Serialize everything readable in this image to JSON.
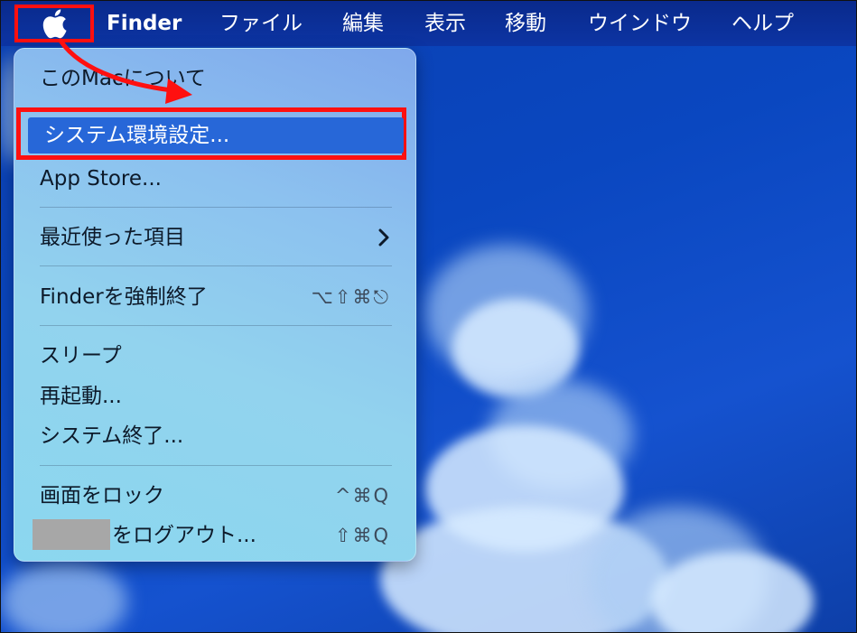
{
  "menubar": {
    "app_name": "Finder",
    "items": [
      "ファイル",
      "編集",
      "表示",
      "移動",
      "ウインドウ",
      "ヘルプ"
    ],
    "apple_icon": "apple-icon",
    "background": "#0c34a3"
  },
  "apple_menu": {
    "items": {
      "about": "このMacについて",
      "preferences": "システム環境設定...",
      "app_store": "App Store...",
      "recent_items": "最近使った項目",
      "force_quit": "Finderを強制終了",
      "force_quit_shortcut": "⌥⇧⌘⎋",
      "sleep": "スリープ",
      "restart": "再起動...",
      "shutdown": "システム終了...",
      "lock_screen": "画面をロック",
      "lock_screen_shortcut": "^⌘Q",
      "logout": "をログアウト...",
      "logout_shortcut": "⇧⌘Q"
    },
    "highlight_color": "#2767d8"
  },
  "annotation": {
    "box_color": "#ff1010",
    "arrow_color": "#ff1010"
  }
}
